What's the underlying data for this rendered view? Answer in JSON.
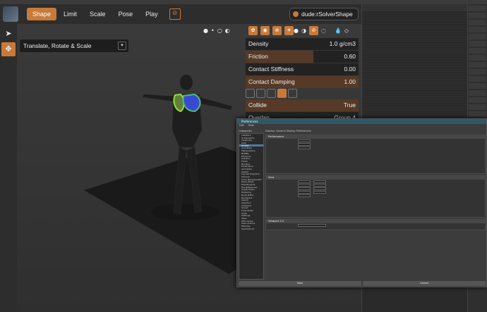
{
  "toolbar": {
    "tabs": [
      "Shape",
      "Limit",
      "Scale",
      "Pose",
      "Play"
    ],
    "active_tab": "Shape",
    "solver_shape": "dude:rSolverShape"
  },
  "manipulator": {
    "label": "Translate, Rotate & Scale"
  },
  "properties": [
    {
      "label": "Density",
      "value": "1.0 g/cm3"
    },
    {
      "label": "Friction",
      "value": "0.60"
    },
    {
      "label": "Contact Stiffness",
      "value": "0.00"
    },
    {
      "label": "Contact Damping",
      "value": "1.00"
    },
    {
      "label": "Collide",
      "value": "True"
    },
    {
      "label": "Overlap",
      "value": "Group 4"
    }
  ],
  "properties_fill": {
    "Friction": 0.6,
    "Contact Damping": 1.0
  },
  "colors": {
    "accent": "#c87a3a",
    "panel": "#222222",
    "shape_green": "#8fe03a",
    "shape_blue": "#3a4ad0"
  },
  "prefs": {
    "title": "Preferences",
    "menu": [
      "Edit",
      "Help"
    ],
    "categories_label": "Categories",
    "main_header": "Display: General Display Preferences",
    "sections": [
      "Performance",
      "View",
      "Viewport 2.0"
    ],
    "categories": [
      "Interface",
      "UI Elements",
      "ViewCube",
      "Help",
      "Display",
      "Animation",
      "Manipulators",
      "NURBS",
      "Polygons",
      "Subdivs",
      "Fluids",
      "Nucleus",
      "Kinematics",
      "Animation",
      "Assets",
      "Cached Playback",
      "Camera",
      "Color Management",
      "Dope Sheet",
      "Files/Projects",
      "File References",
      "Graph Editor",
      "Modeling",
      "Node Editor",
      "Rendering",
      "Search",
      "Selection",
      "Snapping",
      "Sound",
      "Time Slider",
      "Undo",
      "Settings",
      "XGen",
      "GPU Cache",
      "Save Actions",
      "Modules",
      "Applications"
    ],
    "buttons": [
      "Save",
      "Cancel"
    ]
  }
}
